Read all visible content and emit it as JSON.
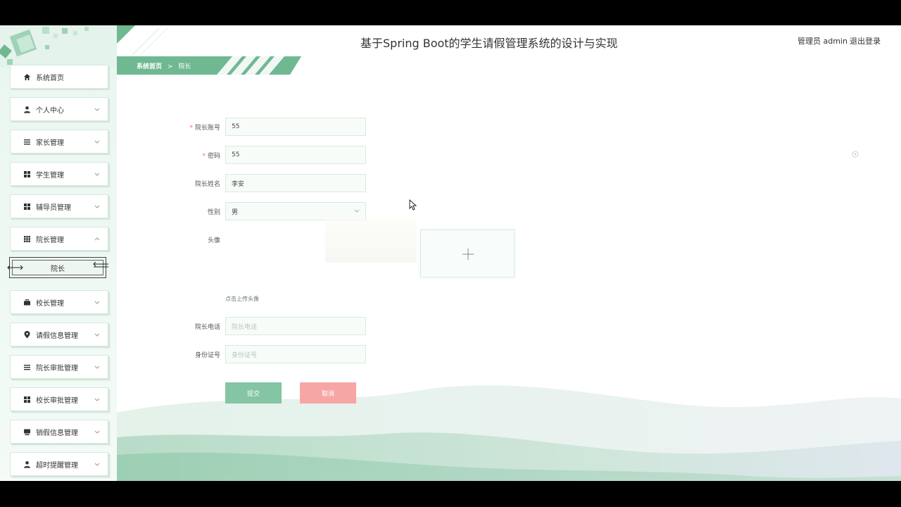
{
  "header": {
    "title": "基于Spring Boot的学生请假管理系统的设计与实现",
    "user_label": "管理员 admin",
    "logout_label": "退出登录"
  },
  "breadcrumb": {
    "home": "系统首页",
    "separator": ">",
    "current": "院长"
  },
  "sidebar": {
    "items": [
      {
        "label": "系统首页",
        "icon": "home-icon",
        "has_chevron": false
      },
      {
        "label": "个人中心",
        "icon": "user-icon",
        "has_chevron": true
      },
      {
        "label": "家长管理",
        "icon": "list-icon",
        "has_chevron": true
      },
      {
        "label": "学生管理",
        "icon": "grid-icon",
        "has_chevron": true
      },
      {
        "label": "辅导员管理",
        "icon": "grid-icon",
        "has_chevron": true
      },
      {
        "label": "院长管理",
        "icon": "apps-icon",
        "has_chevron": true,
        "expanded": true
      },
      {
        "label": "校长管理",
        "icon": "briefcase-icon",
        "has_chevron": true
      },
      {
        "label": "请假信息管理",
        "icon": "location-icon",
        "has_chevron": true
      },
      {
        "label": "院长审批管理",
        "icon": "list-icon",
        "has_chevron": true
      },
      {
        "label": "校长审批管理",
        "icon": "grid-icon",
        "has_chevron": true
      },
      {
        "label": "销假信息管理",
        "icon": "monitor-icon",
        "has_chevron": true
      },
      {
        "label": "超时提醒管理",
        "icon": "user-icon",
        "has_chevron": true
      }
    ],
    "submenu": {
      "label": "院长"
    }
  },
  "form": {
    "account": {
      "label": "院长账号",
      "required": true,
      "value": "55"
    },
    "password": {
      "label": "密码",
      "required": true,
      "value": "55"
    },
    "name": {
      "label": "院长姓名",
      "value": "李安"
    },
    "gender": {
      "label": "性别",
      "value": "男"
    },
    "avatar": {
      "label": "头像",
      "upload_hint": "点击上传头像"
    },
    "phone": {
      "label": "院长电话",
      "placeholder": "院长电话"
    },
    "id_card": {
      "label": "身份证号",
      "placeholder": "身份证号"
    },
    "submit_label": "提交",
    "cancel_label": "取消"
  },
  "colors": {
    "accent": "#6fb892",
    "submit": "#83c5a4",
    "cancel": "#f7a6a6",
    "required": "#f56c6c"
  }
}
